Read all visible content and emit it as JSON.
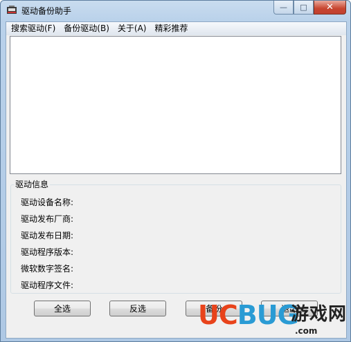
{
  "window": {
    "title": "驱动备份助手",
    "controls": {
      "minimize": "—",
      "maximize": "□",
      "close": "✕"
    }
  },
  "menu": [
    "搜索驱动(F)",
    "备份驱动(B)",
    "关于(A)",
    "精彩推荐"
  ],
  "driver_list": {
    "items": []
  },
  "info_group": {
    "title": "驱动信息",
    "rows": [
      "驱动设备名称:",
      "驱动发布厂商:",
      "驱动发布日期:",
      "驱动程序版本:",
      "微软数字签名:",
      "驱动程序文件:"
    ]
  },
  "buttons": {
    "select_all": "全选",
    "invert": "反选",
    "backup": "备份",
    "exit": "退出"
  },
  "watermark": {
    "logo": "UCBUG",
    "text": "游戏网",
    "url": ".com"
  },
  "colors": {
    "accent_orange": "#e8431b",
    "accent_blue": "#2a9bd4"
  }
}
